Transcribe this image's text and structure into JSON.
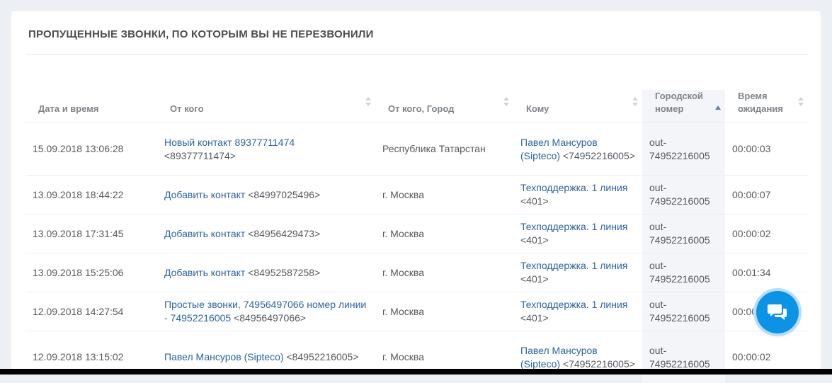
{
  "panel": {
    "title": "ПРОПУЩЕННЫЕ ЗВОНКИ, ПО КОТОРЫМ ВЫ НЕ ПЕРЕЗВОНИЛИ"
  },
  "table": {
    "columns": {
      "datetime": "Дата и время",
      "from": "От кого",
      "from_city": "От кого, Город",
      "to": "Кому",
      "city_number": "Городской номер",
      "wait_time": "Время ожидания"
    },
    "rows": [
      {
        "datetime": "15.09.2018 13:06:28",
        "from_link": "Новый контакт 89377711474",
        "from_number": "<89377711474>",
        "city": "Республика Татарстан",
        "to_link": "Павел Мансуров (Sipteco)",
        "to_ext": "<74952216005>",
        "city_number": "out-74952216005",
        "wait": "00:00:03"
      },
      {
        "datetime": "13.09.2018 18:44:22",
        "from_link": "Добавить контакт",
        "from_number": "<84997025496>",
        "city": "г. Москва",
        "to_link": "Техподдержка. 1 линия",
        "to_ext": "<401>",
        "city_number": "out-74952216005",
        "wait": "00:00:07"
      },
      {
        "datetime": "13.09.2018 17:31:45",
        "from_link": "Добавить контакт",
        "from_number": "<84956429473>",
        "city": "г. Москва",
        "to_link": "Техподдержка. 1 линия",
        "to_ext": "<401>",
        "city_number": "out-74952216005",
        "wait": "00:00:02"
      },
      {
        "datetime": "13.09.2018 15:25:06",
        "from_link": "Добавить контакт",
        "from_number": "<84952587258>",
        "city": "г. Москва",
        "to_link": "Техподдержка. 1 линия",
        "to_ext": "<401>",
        "city_number": "out-74952216005",
        "wait": "00:01:34"
      },
      {
        "datetime": "12.09.2018 14:27:54",
        "from_link": "Простые звонки, 74956497066 номер линии - 74952216005",
        "from_number": "<84956497066>",
        "city": "г. Москва",
        "to_link": "Техподдержка. 1 линия",
        "to_ext": "<401>",
        "city_number": "out-74952216005",
        "wait": "00:00:0"
      },
      {
        "datetime": "12.09.2018 13:15:02",
        "from_link": "Павел Мансуров (Sipteco)",
        "from_number": "<84952216005>",
        "city": "г. Москва",
        "to_link": "Павел Мансуров (Sipteco)",
        "to_ext": "<74952216005>",
        "city_number": "out-74952216005",
        "wait": "00:00:02"
      }
    ]
  },
  "chat_button": {
    "icon": "chat-bubbles-icon",
    "color": "#0b93e6"
  },
  "colors": {
    "link": "#2b63a5",
    "sort_active": "#6a79c9"
  }
}
